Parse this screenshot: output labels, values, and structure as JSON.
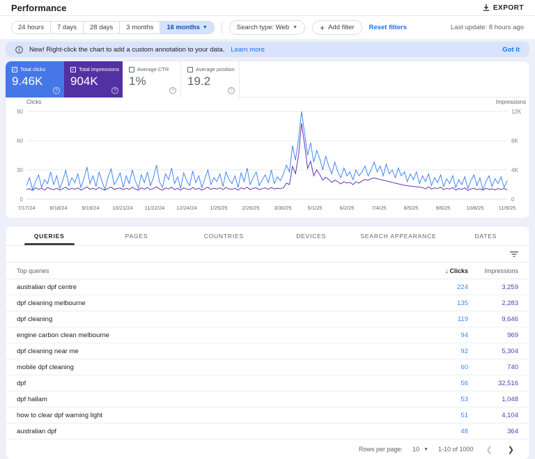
{
  "header": {
    "title": "Performance",
    "export_label": "EXPORT"
  },
  "filters": {
    "date_ranges": [
      "24 hours",
      "7 days",
      "28 days",
      "3 months",
      "16 months"
    ],
    "selected_range": "16 months",
    "search_type": "Search type: Web",
    "add_filter_label": "Add filter",
    "reset_filters": "Reset filters",
    "last_update": "Last update: 8 hours ago"
  },
  "banner": {
    "text": "New! Right-click the chart to add a custom annotation to your data.",
    "link": "Learn more",
    "dismiss": "Got it"
  },
  "metrics": [
    {
      "label": "Total clicks",
      "value": "9.46K",
      "checked": true,
      "color": "#4677e8"
    },
    {
      "label": "Total impressions",
      "value": "904K",
      "checked": true,
      "color": "#5231a3"
    },
    {
      "label": "Average CTR",
      "value": "1%",
      "checked": false,
      "color": ""
    },
    {
      "label": "Average position",
      "value": "19.2",
      "checked": false,
      "color": ""
    }
  ],
  "chart_data": {
    "type": "line",
    "title": "",
    "left_axis": {
      "label": "Clicks",
      "ticks": [
        90,
        60,
        30,
        0
      ],
      "max": 90
    },
    "right_axis": {
      "label": "Impressions",
      "ticks": [
        "12K",
        "8K",
        "4K",
        "0"
      ],
      "max": 12000
    },
    "x_labels": [
      "7/17/24",
      "8/18/24",
      "9/19/24",
      "10/21/24",
      "11/22/24",
      "12/24/24",
      "1/25/25",
      "2/26/25",
      "3/30/25",
      "5/1/25",
      "6/2/25",
      "7/4/25",
      "8/5/25",
      "9/6/25",
      "10/8/25",
      "11/9/25"
    ],
    "grid": true,
    "legend_position": "none",
    "series": [
      {
        "name": "Total clicks",
        "axis": "left",
        "color": "#4285f4",
        "values": [
          14,
          22,
          10,
          18,
          25,
          12,
          20,
          16,
          28,
          15,
          24,
          11,
          19,
          30,
          14,
          22,
          17,
          26,
          12,
          21,
          33,
          16,
          24,
          13,
          28,
          18,
          10,
          23,
          31,
          15,
          20,
          27,
          12,
          24,
          16,
          30,
          19,
          11,
          25,
          17,
          28,
          14,
          22,
          35,
          18,
          12,
          26,
          20,
          32,
          16,
          23,
          11,
          27,
          19,
          14,
          29,
          17,
          24,
          12,
          21,
          30,
          15,
          22,
          18,
          26,
          13,
          28,
          20,
          16,
          24,
          12,
          27,
          18,
          32,
          15,
          22,
          28,
          14,
          20,
          25,
          17,
          30,
          16,
          23,
          19,
          26,
          35,
          28,
          55,
          40,
          62,
          90,
          68,
          45,
          58,
          38,
          50,
          42,
          30,
          44,
          34,
          26,
          38,
          28,
          22,
          32,
          24,
          28,
          20,
          30,
          24,
          28,
          34,
          24,
          30,
          38,
          28,
          34,
          24,
          36,
          26,
          30,
          22,
          32,
          24,
          28,
          18,
          26,
          20,
          28,
          16,
          24,
          18,
          26,
          14,
          22,
          17,
          25,
          13,
          21,
          16,
          24,
          12,
          20,
          15,
          23,
          11,
          19,
          25,
          14,
          22,
          10,
          18,
          24,
          13,
          21,
          16,
          23,
          12,
          19
        ]
      },
      {
        "name": "Total impressions",
        "axis": "right",
        "color": "#5e35b1",
        "values": [
          1300,
          1450,
          1200,
          1550,
          1350,
          1500,
          1250,
          1600,
          1400,
          1300,
          1500,
          1250,
          1450,
          1650,
          1300,
          1500,
          1350,
          1550,
          1250,
          1450,
          1700,
          1350,
          1500,
          1300,
          1600,
          1400,
          1250,
          1500,
          1650,
          1350,
          1450,
          1550,
          1300,
          1500,
          1350,
          1650,
          1400,
          1250,
          1550,
          1350,
          1600,
          1300,
          1450,
          1700,
          1400,
          1250,
          1550,
          1400,
          1650,
          1300,
          1500,
          1250,
          1550,
          1400,
          1300,
          1600,
          1350,
          1500,
          1250,
          1450,
          1650,
          1350,
          1500,
          1400,
          1550,
          1300,
          1600,
          1400,
          1350,
          1500,
          1250,
          1550,
          1400,
          1650,
          1300,
          1500,
          1550,
          1300,
          1450,
          1550,
          1350,
          1600,
          1400,
          1500,
          1450,
          1550,
          2200,
          2000,
          4500,
          3500,
          6000,
          10400,
          7500,
          4200,
          5200,
          3200,
          4000,
          3400,
          2600,
          3000,
          2700,
          2300,
          2600,
          2400,
          2100,
          2400,
          2200,
          2300,
          2000,
          2400,
          2200,
          2500,
          2700,
          2600,
          2800,
          2900,
          2800,
          2700,
          2600,
          2500,
          2400,
          2300,
          2200,
          2100,
          2000,
          1900,
          1850,
          1800,
          1750,
          1700,
          1650,
          1600,
          1400,
          1700,
          1350,
          1550,
          1450,
          1650,
          1300,
          1500,
          1400,
          1600,
          1250,
          1450,
          1350,
          1550,
          1200,
          1400,
          1500,
          1300,
          1450,
          1250,
          1500,
          1350,
          1420,
          1280,
          1460,
          1320,
          1480,
          1260
        ]
      }
    ]
  },
  "tabs": [
    {
      "label": "QUERIES",
      "active": true
    },
    {
      "label": "PAGES",
      "active": false
    },
    {
      "label": "COUNTRIES",
      "active": false
    },
    {
      "label": "DEVICES",
      "active": false
    },
    {
      "label": "SEARCH APPEARANCE",
      "active": false
    },
    {
      "label": "DATES",
      "active": false
    }
  ],
  "table": {
    "columns": {
      "primary": "Top queries",
      "clicks": "Clicks",
      "impressions": "Impressions"
    },
    "rows": [
      {
        "query": "australian dpf centre",
        "clicks": "224",
        "impressions": "3,259"
      },
      {
        "query": "dpf cleaning melbourne",
        "clicks": "135",
        "impressions": "2,283"
      },
      {
        "query": "dpf cleaning",
        "clicks": "119",
        "impressions": "9,646"
      },
      {
        "query": "engine carbon clean melbourne",
        "clicks": "94",
        "impressions": "969"
      },
      {
        "query": "dpf cleaning near me",
        "clicks": "92",
        "impressions": "5,304"
      },
      {
        "query": "mobile dpf cleaning",
        "clicks": "60",
        "impressions": "740"
      },
      {
        "query": "dpf",
        "clicks": "56",
        "impressions": "32,516"
      },
      {
        "query": "dpf hallam",
        "clicks": "53",
        "impressions": "1,048"
      },
      {
        "query": "how to clear dpf warning light",
        "clicks": "51",
        "impressions": "4,104"
      },
      {
        "query": "australian dpf",
        "clicks": "48",
        "impressions": "364"
      }
    ]
  },
  "pagination": {
    "rows_per_page_label": "Rows per page:",
    "rows_per_page": "10",
    "range": "1-10 of 1000"
  }
}
